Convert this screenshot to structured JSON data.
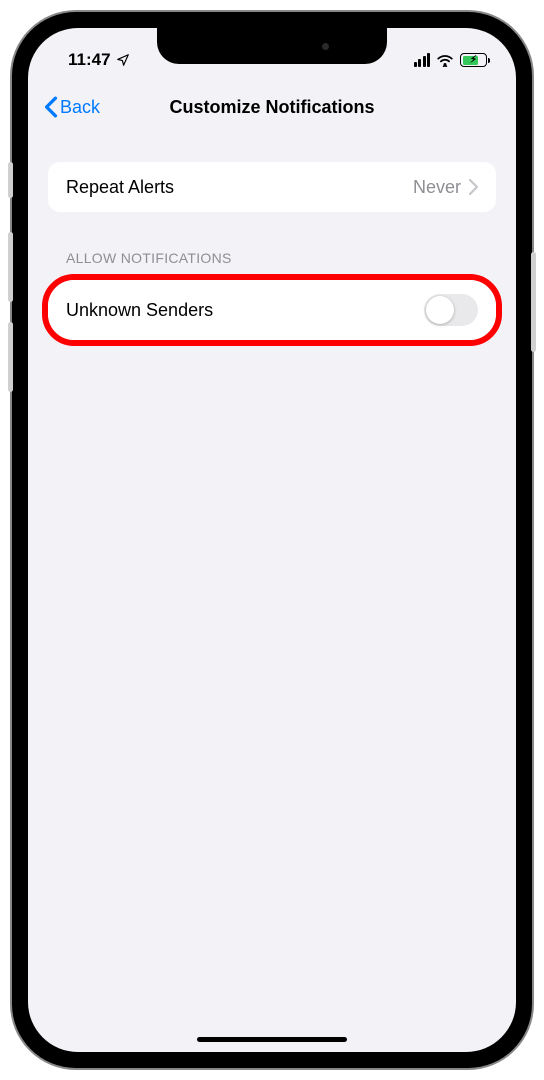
{
  "statusBar": {
    "time": "11:47"
  },
  "nav": {
    "back": "Back",
    "title": "Customize Notifications"
  },
  "repeatAlerts": {
    "label": "Repeat Alerts",
    "value": "Never"
  },
  "sectionHeader": "ALLOW NOTIFICATIONS",
  "unknownSenders": {
    "label": "Unknown Senders",
    "enabled": false
  }
}
